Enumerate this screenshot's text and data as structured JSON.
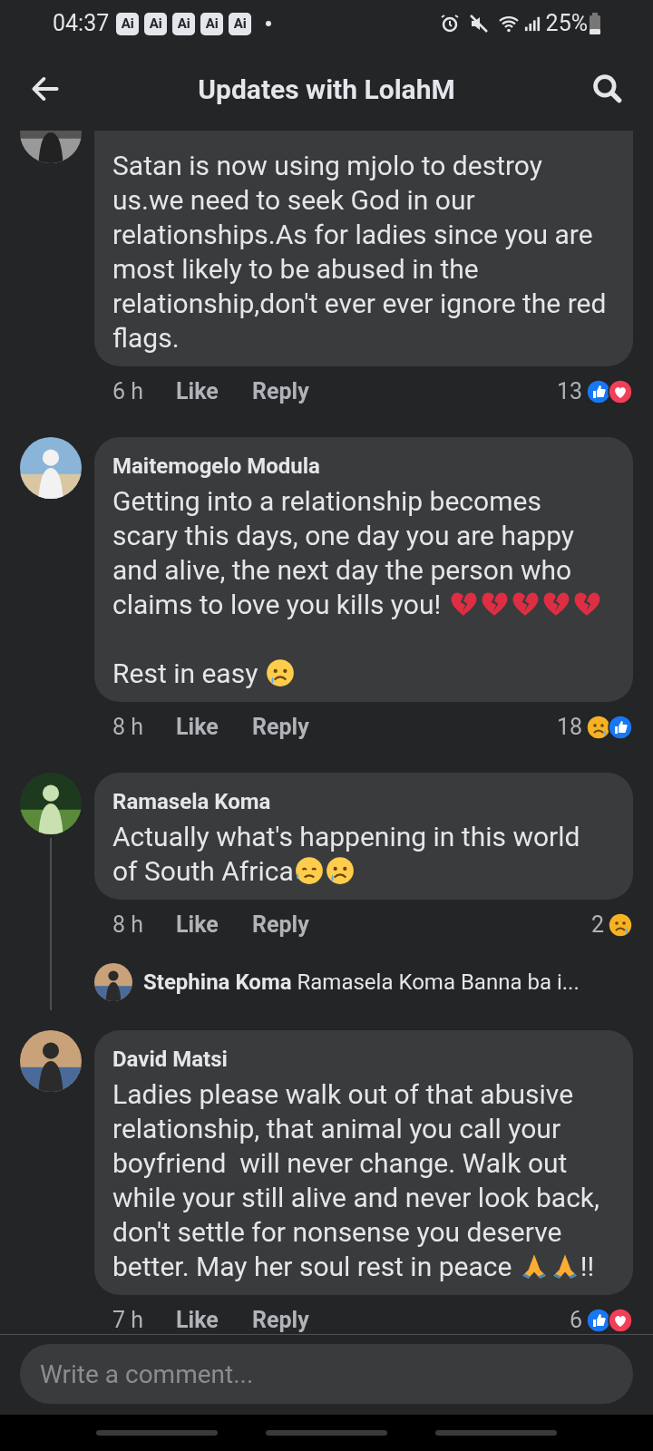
{
  "status_bar": {
    "time": "04:37",
    "badges": [
      "Ai",
      "Ai",
      "Ai",
      "Ai",
      "Ai"
    ],
    "battery": "25%"
  },
  "header": {
    "title": "Updates with LolahM"
  },
  "comments": [
    {
      "kind": "cut",
      "body": [
        [
          {
            "kind": "text",
            "text": "Satan is now using mjolo to destroy us.we need to seek God in our relationships.As for ladies since you are most likely to be abused in the relationship,don't ever ever ignore the red flags."
          }
        ]
      ],
      "time": "6 h",
      "like": "Like",
      "reply": "Reply",
      "count": "13",
      "reactions": [
        {
          "kind": "like"
        },
        {
          "kind": "love"
        }
      ]
    },
    {
      "kind": "full",
      "author": "Maitemogelo Modula",
      "body": [
        [
          {
            "kind": "text",
            "text": "Getting into a relationship becomes scary this days, one day you are happy and alive, the next day the person who claims to love you kills you! "
          },
          {
            "kind": "broken_heart"
          },
          {
            "kind": "broken_heart"
          },
          {
            "kind": "broken_heart"
          },
          {
            "kind": "broken_heart"
          },
          {
            "kind": "broken_heart"
          }
        ],
        [
          {
            "kind": "text",
            "text": "Rest in easy "
          },
          {
            "kind": "sad"
          }
        ]
      ],
      "time": "8 h",
      "like": "Like",
      "reply": "Reply",
      "count": "18",
      "reactions": [
        {
          "kind": "sad"
        },
        {
          "kind": "like"
        }
      ]
    },
    {
      "kind": "full",
      "author": "Ramasela Koma",
      "body": [
        [
          {
            "kind": "text",
            "text": "Actually what's happening in this world of South Africa"
          },
          {
            "kind": "sweat"
          },
          {
            "kind": "sad"
          }
        ]
      ],
      "time": "8 h",
      "like": "Like",
      "reply": "Reply",
      "count": "2",
      "reactions": [
        {
          "kind": "sad"
        }
      ],
      "replies": [
        {
          "author": "Stephina Koma",
          "text": "Ramasela Koma Banna ba i..."
        }
      ]
    },
    {
      "kind": "full",
      "author": "David Matsi",
      "body": [
        [
          {
            "kind": "text",
            "text": "Ladies please walk out of that abusive relationship, that animal you call your boyfriend  will never change. Walk out while your still alive and never look back, don't settle for nonsense you deserve better. May her soul rest in peace "
          },
          {
            "kind": "pray"
          },
          {
            "kind": "pray"
          },
          {
            "kind": "text",
            "text": "!!"
          }
        ]
      ],
      "time": "7 h",
      "like": "Like",
      "reply": "Reply",
      "count": "6",
      "reactions": [
        {
          "kind": "like"
        },
        {
          "kind": "love"
        }
      ]
    }
  ],
  "composer": {
    "placeholder": "Write a comment..."
  }
}
